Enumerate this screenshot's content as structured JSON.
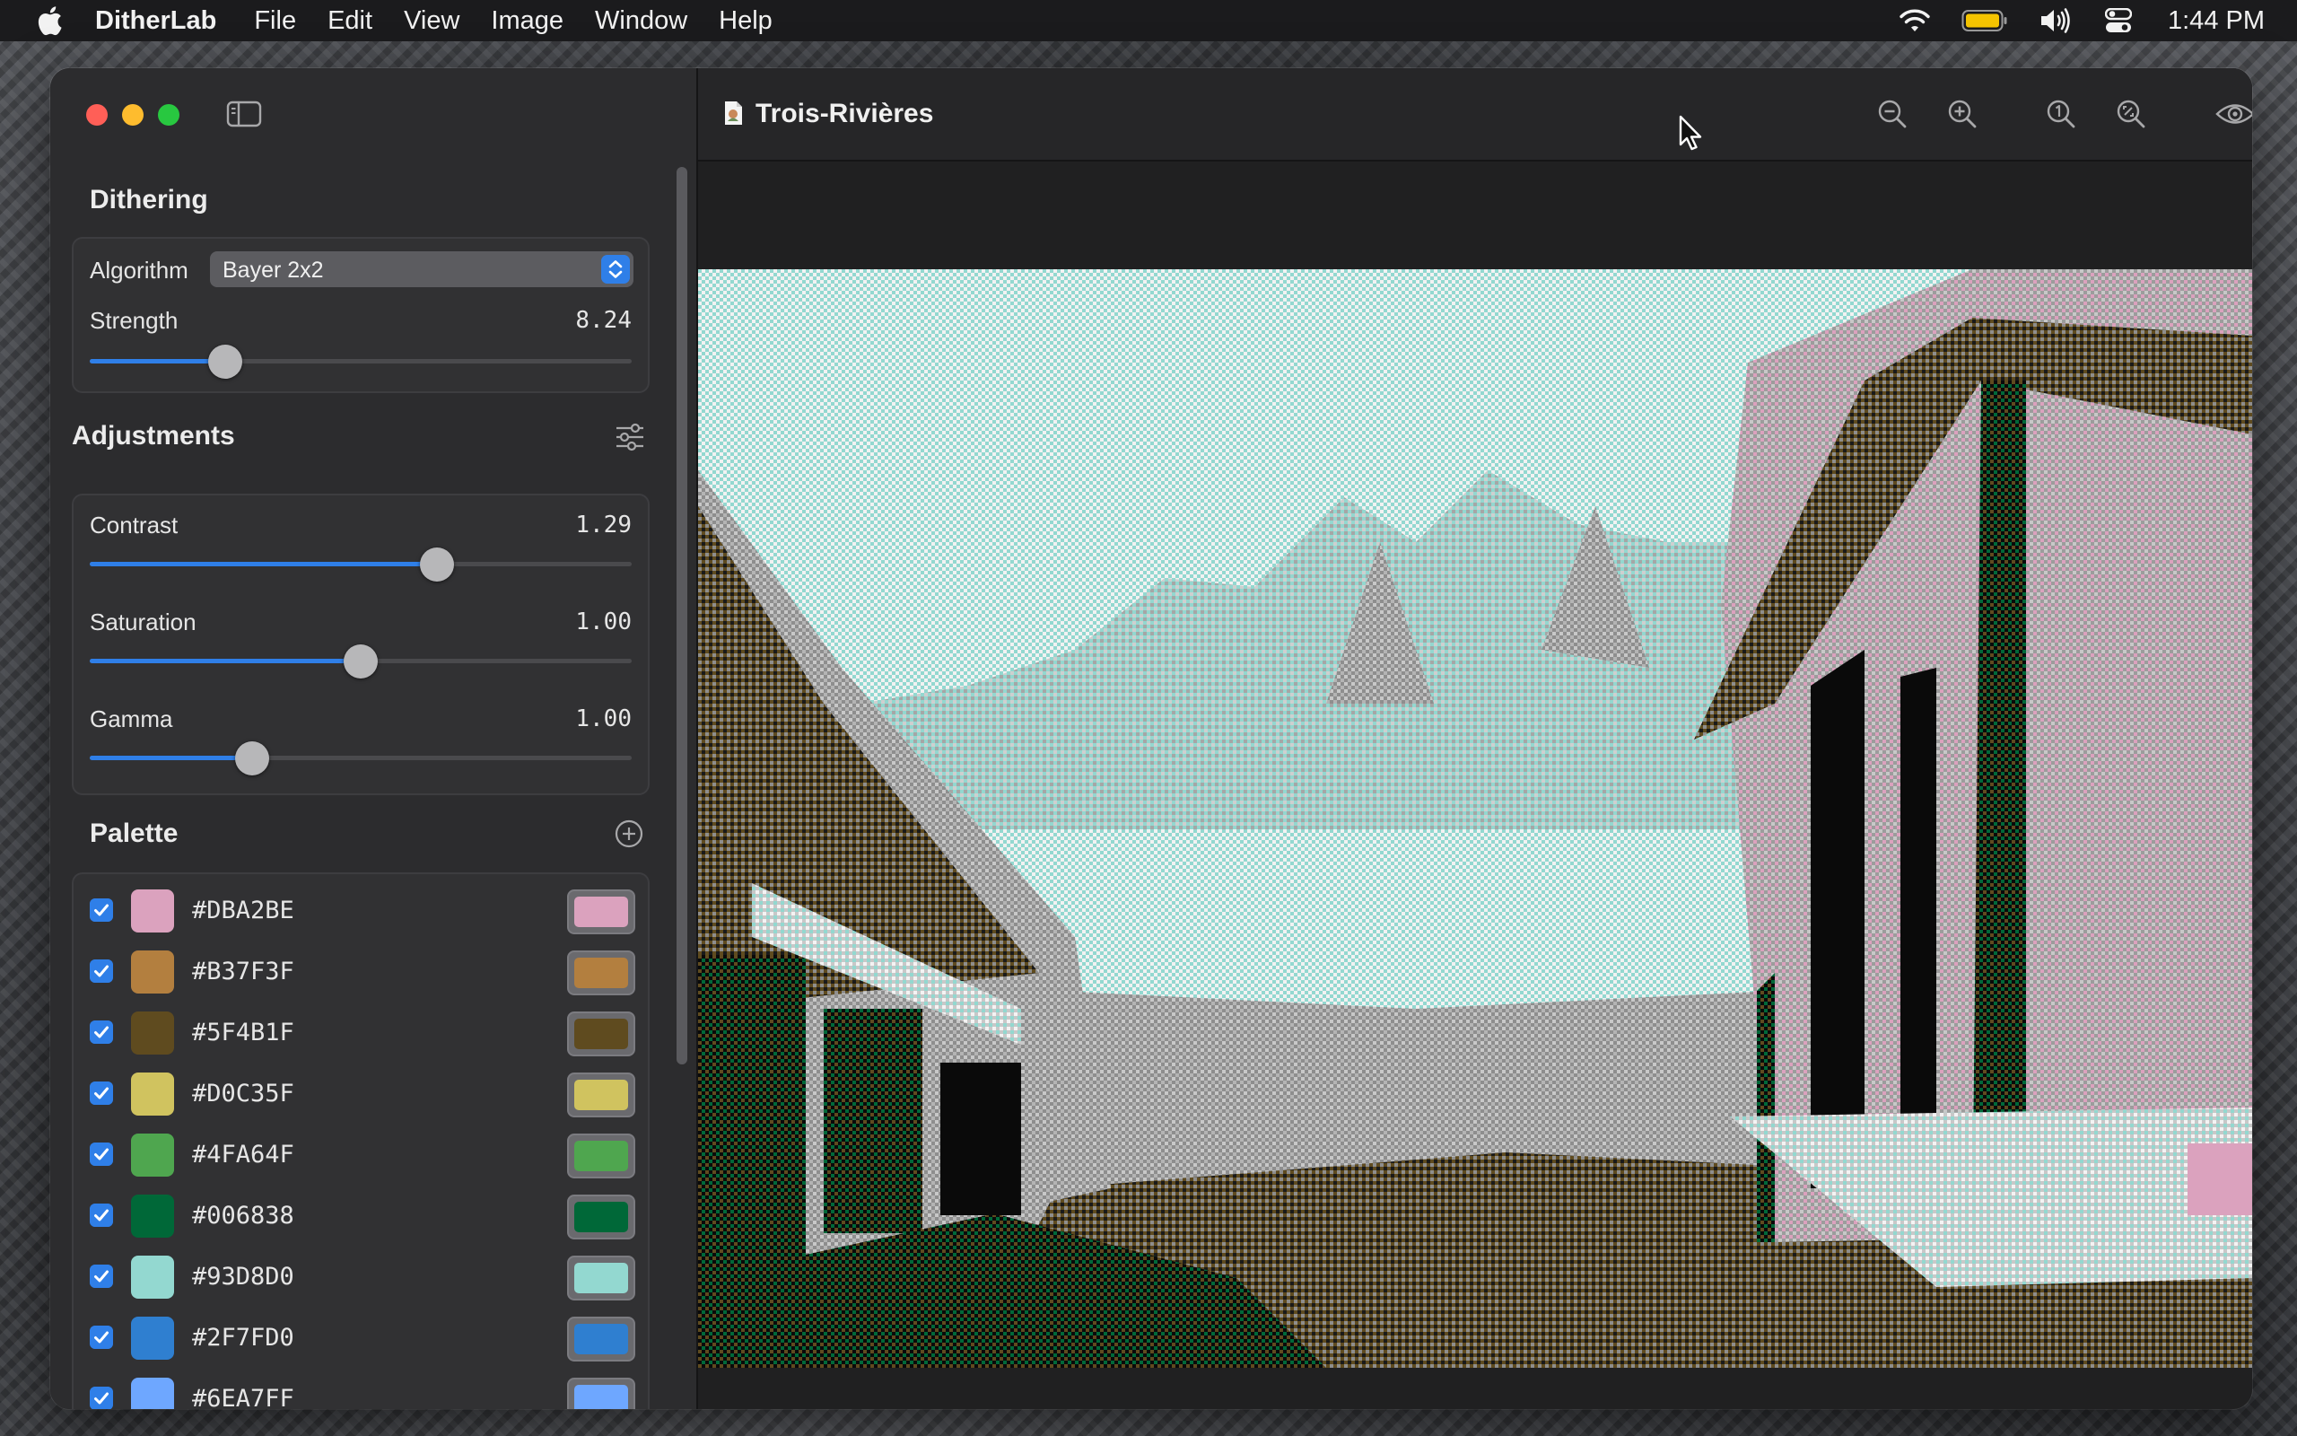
{
  "menubar": {
    "app_name": "DitherLab",
    "items": [
      "File",
      "Edit",
      "View",
      "Image",
      "Window",
      "Help"
    ],
    "clock": "1:44 PM",
    "status_icons": [
      "wifi-icon",
      "battery-icon",
      "volume-icon",
      "control-center-icon"
    ]
  },
  "sidebar": {
    "dithering": {
      "title": "Dithering",
      "algorithm_label": "Algorithm",
      "algorithm_value": "Bayer 2x2",
      "strength_label": "Strength",
      "strength_value": "8.24",
      "strength_level": 0.25
    },
    "adjustments": {
      "title": "Adjustments",
      "contrast_label": "Contrast",
      "contrast_value": "1.29",
      "contrast_level": 0.64,
      "saturation_label": "Saturation",
      "saturation_value": "1.00",
      "saturation_level": 0.5,
      "gamma_label": "Gamma",
      "gamma_value": "1.00",
      "gamma_level": 0.3
    },
    "palette": {
      "title": "Palette",
      "colors": [
        {
          "hex": "#DBA2BE",
          "enabled": true
        },
        {
          "hex": "#B37F3F",
          "enabled": true
        },
        {
          "hex": "#5F4B1F",
          "enabled": true
        },
        {
          "hex": "#D0C35F",
          "enabled": true
        },
        {
          "hex": "#4FA64F",
          "enabled": true
        },
        {
          "hex": "#006838",
          "enabled": true
        },
        {
          "hex": "#93D8D0",
          "enabled": true
        },
        {
          "hex": "#2F7FD0",
          "enabled": true
        },
        {
          "hex": "#6EA7FF",
          "enabled": true
        }
      ]
    }
  },
  "document": {
    "title": "Trois-Rivières"
  },
  "toolbar_icons": [
    "zoom-out-icon",
    "zoom-in-icon",
    "actual-size-icon",
    "zoom-to-fit-icon",
    "preview-eye-icon"
  ],
  "colors": {
    "accent": "#2F7FE8",
    "sidebar_bg": "#2C2C2E",
    "canvas_black": "#0A0A0A",
    "canvas_gray": "#8E8E8E",
    "canvas_light": "#C8C8C8"
  }
}
